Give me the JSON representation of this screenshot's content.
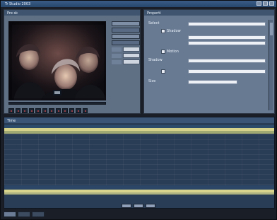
{
  "window": {
    "title": "Tr     Studio 2003",
    "controls": [
      "minimize-icon",
      "maximize-icon",
      "close-icon"
    ]
  },
  "left_pane": {
    "header_label": "Pre     sk"
  },
  "right_pane": {
    "header_label": "Properti",
    "checkboxes": [
      {
        "label": "Shadow"
      },
      {
        "label": "Motion"
      }
    ],
    "fields": [
      {
        "label": "Select",
        "value": ""
      },
      {
        "label": "Shadow",
        "value": ""
      },
      {
        "label": "Size",
        "value": ""
      }
    ]
  },
  "bottom_pane": {
    "header_label": "Time"
  },
  "footer": {
    "buttons": [
      "",
      "",
      ""
    ]
  },
  "tabs": [
    {
      "label": "",
      "active": true
    },
    {
      "label": "",
      "active": false
    },
    {
      "label": "",
      "active": false
    }
  ]
}
